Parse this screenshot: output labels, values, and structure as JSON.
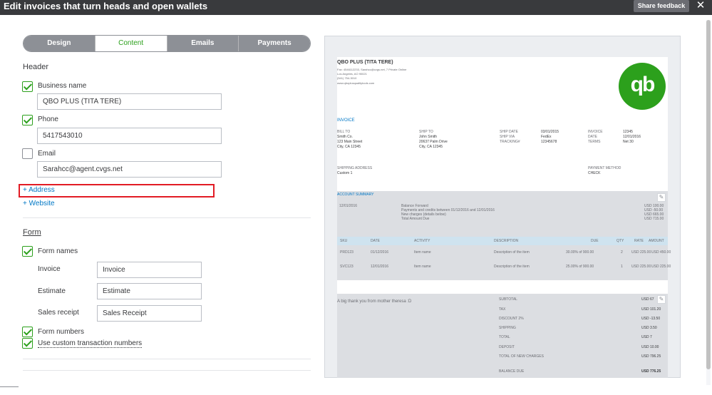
{
  "header": {
    "title": "Edit invoices that turn heads and open wallets",
    "feedback_label": "Share feedback",
    "close_glyph": "✕"
  },
  "tabs": [
    {
      "label": "Design"
    },
    {
      "label": "Content"
    },
    {
      "label": "Emails"
    },
    {
      "label": "Payments"
    }
  ],
  "header_section": {
    "title": "Header",
    "business_name": {
      "label": "Business name",
      "value": "QBO PLUS (TITA TERE)",
      "checked": true
    },
    "phone": {
      "label": "Phone",
      "value": "5417543010",
      "checked": true
    },
    "email": {
      "label": "Email",
      "value": "Sarahcc@agent.cvgs.net",
      "checked": false
    },
    "address_link": "+ Address",
    "website_link": "+ Website"
  },
  "form_section": {
    "title": "Form",
    "form_names_label": "Form names",
    "invoice": {
      "label": "Invoice",
      "value": "Invoice"
    },
    "estimate": {
      "label": "Estimate",
      "value": "Estimate"
    },
    "sales_receipt": {
      "label": "Sales receipt",
      "value": "Sales Receipt"
    },
    "form_numbers_label": "Form numbers",
    "custom_numbers_label": "Use custom transaction numbers"
  },
  "preview": {
    "company": "QBO PLUS (TITA TERE)",
    "company_lines": [
      "Fax: 4546112233, Sarahcc@cvgs.net, 7 Private Online",
      "Los Angeles, AO 90021",
      "(541) 754-3010",
      "www.qboplusqualitytools.com"
    ],
    "logo_text": "qb",
    "invoice_label": "INVOICE",
    "bill_to": {
      "label": "BILL TO",
      "lines": [
        "Smith Co.",
        "123 Main Street",
        "City, CA 12345"
      ]
    },
    "ship_to": {
      "label": "SHIP TO",
      "lines": [
        "John Smith",
        "20637 Palm Drive",
        "City, CA 12345"
      ]
    },
    "ship_info": {
      "labels": [
        "SHIP DATE",
        "SHIP VIA",
        "TRACKING#"
      ],
      "values": [
        "03/01/2015",
        "FedEx",
        "12345678"
      ]
    },
    "inv_info": {
      "labels": [
        "INVOICE",
        "DATE",
        "TERMS"
      ],
      "values": [
        "12345",
        "12/01/2016",
        "Net 30"
      ]
    },
    "shipping_address": {
      "label": "SHIPPING ADDRESS",
      "value": "Custom 1"
    },
    "payment_method": {
      "label": "PAYMENT METHOD",
      "value": "CHECK"
    },
    "account_summary": {
      "title": "ACCOUNT SUMMARY",
      "date": "12/01/2016",
      "lines": [
        "Balance Forward",
        "Payments and credits between 01/12/2016 and 12/01/2016",
        "New charges (details below)",
        "Total Amount Due"
      ],
      "amounts": [
        "USD 100.00",
        "USD -50.00",
        "USD 665.00",
        "USD 715.00"
      ]
    },
    "table_headers": [
      "SKU",
      "DATE",
      "ACTIVITY",
      "DESCRIPTION",
      "DUE",
      "QTY",
      "RATE",
      "AMOUNT"
    ],
    "rows": [
      {
        "sku": "PRD123",
        "date": "01/12/2016",
        "activity": "Item name",
        "desc": "Description of the item",
        "due": "30.00% of 900.00",
        "qty": "2",
        "rate": "USD 225.00",
        "amount": "USD 450.00"
      },
      {
        "sku": "SVC123",
        "date": "12/01/2016",
        "activity": "Item name",
        "desc": "Description of the item",
        "due": "25.00% of 900.00",
        "qty": "1",
        "rate": "USD 225.00",
        "amount": "USD 225.00"
      }
    ],
    "message": "A big thank you from mother theresa :D",
    "totals_labels": [
      "SUBTOTAL",
      "TAX",
      "DISCOUNT 2%",
      "SHIPPING",
      "TOTAL",
      "DEPOSIT",
      "TOTAL OF NEW CHARGES",
      "BALANCE DUE"
    ],
    "totals_values": [
      "USD 67",
      "USD 101.20",
      "USD -13.50",
      "USD 3.50",
      "USD 7",
      "USD 10.00",
      "USD 796.25",
      "USD 776.25"
    ]
  },
  "colors": {
    "accent": "#2ca01c",
    "link": "#0077c5",
    "highlight": "#e21b24"
  }
}
